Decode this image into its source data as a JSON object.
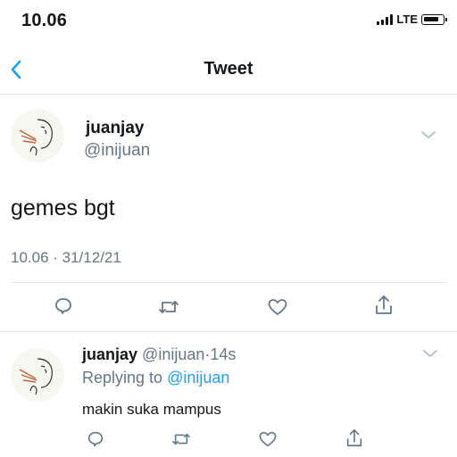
{
  "status_bar": {
    "time": "10.06",
    "network": "LTE"
  },
  "header": {
    "title": "Tweet"
  },
  "tweet": {
    "display_name": "juanjay",
    "handle": "@inijuan",
    "text": "gemes bgt",
    "timestamp": "10.06 · 31/12/21",
    "actions": [
      "reply-icon",
      "retweet-icon",
      "like-icon",
      "share-icon"
    ]
  },
  "reply": {
    "display_name": "juanjay",
    "handle": "@inijuan",
    "age": "14s",
    "replying_prefix": "Replying to",
    "replying_to": "@inijuan",
    "text": "makin suka mampus",
    "actions": [
      "reply-icon",
      "retweet-icon",
      "like-icon",
      "share-icon"
    ]
  },
  "colors": {
    "accent": "#1da1f2",
    "secondary_text": "#657786",
    "divider": "#e1e8ed"
  }
}
